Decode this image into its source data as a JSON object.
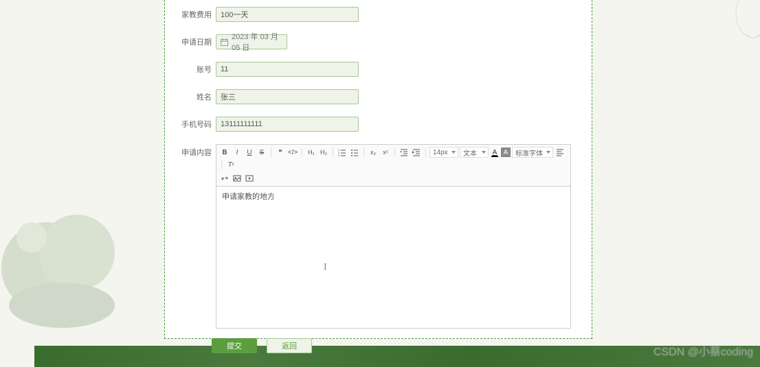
{
  "form": {
    "tutor_fee": {
      "label": "家教费用",
      "value": "100一天"
    },
    "apply_date": {
      "label": "申请日期",
      "value": "2023 年 03 月 05 日"
    },
    "account": {
      "label": "账号",
      "value": "11"
    },
    "name": {
      "label": "姓名",
      "value": "张三"
    },
    "phone": {
      "label": "手机号码",
      "value": "13111111111"
    },
    "content": {
      "label": "申请内容",
      "body": "申请家教的地方"
    }
  },
  "editor": {
    "font_size": "14px",
    "format": "文本",
    "font_family": "标准字体"
  },
  "buttons": {
    "submit": "提交",
    "back": "返回"
  },
  "watermark": "CSDN @小蔡coding",
  "colors": {
    "accent": "#5a9e3e",
    "input_bg": "#eef4e8",
    "input_border": "#a8c794"
  }
}
